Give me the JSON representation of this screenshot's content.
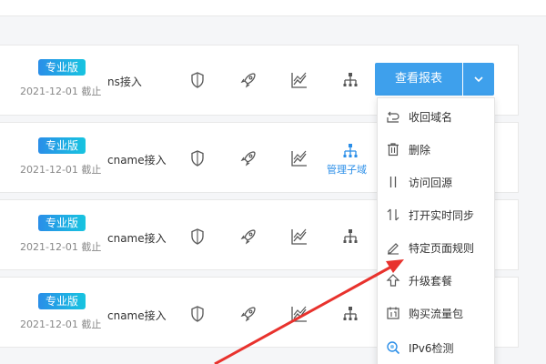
{
  "rows": [
    {
      "badge": "专业版",
      "date": "2021-12-01 截止",
      "access": "ns接入"
    },
    {
      "badge": "专业版",
      "date": "2021-12-01 截止",
      "access": "cname接入",
      "manage_label": "管理子域"
    },
    {
      "badge": "专业版",
      "date": "2021-12-01 截止",
      "access": "cname接入"
    },
    {
      "badge": "专业版",
      "date": "2021-12-01 截止",
      "access": "cname接入"
    }
  ],
  "report_button": "查看报表",
  "menu": [
    {
      "label": "收回域名",
      "icon": "undo-icon"
    },
    {
      "label": "删除",
      "icon": "trash-icon"
    },
    {
      "label": "访问回源",
      "icon": "origin-icon"
    },
    {
      "label": "打开实时同步",
      "icon": "sync-icon"
    },
    {
      "label": "特定页面规则",
      "icon": "pencil-icon"
    },
    {
      "label": "升级套餐",
      "icon": "upgrade-arrow-icon"
    },
    {
      "label": "购买流量包",
      "icon": "calendar-icon"
    },
    {
      "label": "IPv6检测",
      "icon": "search-ipv6-icon"
    }
  ],
  "colors": {
    "accent": "#3ea0ec",
    "badge_from": "#2a8ee8",
    "badge_to": "#17c4e0",
    "annotation_arrow": "#e8322d"
  }
}
